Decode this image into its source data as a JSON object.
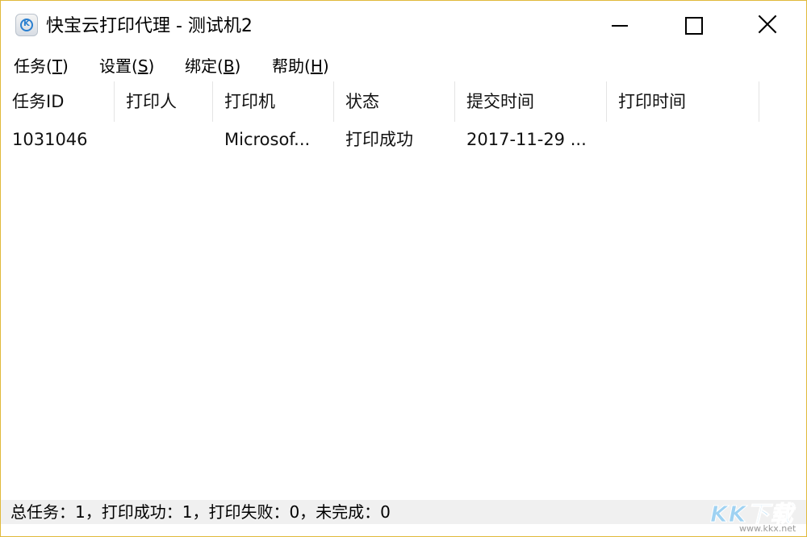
{
  "window": {
    "title": "快宝云打印代理 - 测试机2",
    "icon": "app-logo-icon"
  },
  "menu": [
    {
      "prefix": "任务(",
      "accel": "T",
      "suffix": ")"
    },
    {
      "prefix": "设置(",
      "accel": "S",
      "suffix": ")"
    },
    {
      "prefix": "绑定(",
      "accel": "B",
      "suffix": ")"
    },
    {
      "prefix": "帮助(",
      "accel": "H",
      "suffix": ")"
    }
  ],
  "table": {
    "columns": [
      "任务ID",
      "打印人",
      "打印机",
      "状态",
      "提交时间",
      "打印时间"
    ],
    "rows": [
      [
        "1031046",
        "",
        "Microsof...",
        "打印成功",
        "2017-11-29 ...",
        ""
      ]
    ]
  },
  "status": {
    "summary": "总任务：1，打印成功：1，打印失败：0，未完成：0"
  },
  "watermark": {
    "logo_text": "KK下载",
    "url": "www.kkx.net"
  },
  "colors": {
    "window_border": "#e0b93a",
    "statusbar_bg": "#f0f0f0",
    "watermark": "#9fd2f2"
  }
}
